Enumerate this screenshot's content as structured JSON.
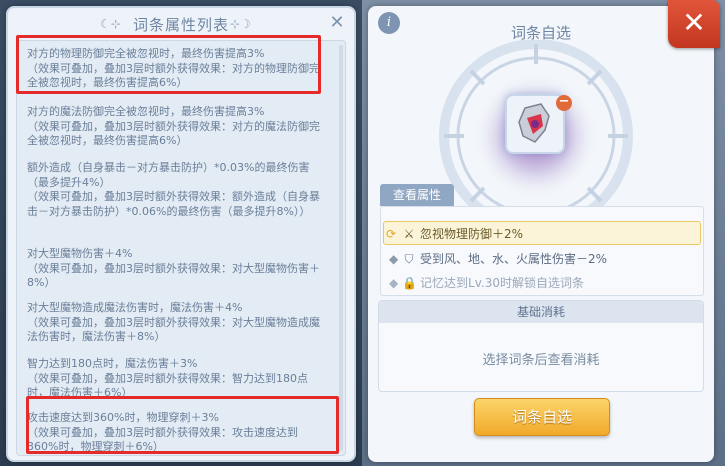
{
  "left": {
    "title": "词条属性列表",
    "items": [
      {
        "main": "对方的物理防御完全被忽视时，最终伤害提高3%",
        "sub": "（效果可叠加，叠加3层时额外获得效果：对方的物理防御完全被忽视时，最终伤害提高6%）"
      },
      {
        "main": "对方的魔法防御完全被忽视时，最终伤害提高3%",
        "sub": "（效果可叠加，叠加3层时额外获得效果：对方的魔法防御完全被忽视时，最终伤害提高6%）"
      },
      {
        "main": "额外造成（自身暴击－对方暴击防护）*0.03%的最终伤害（最多提升4%）",
        "sub": "（效果可叠加，叠加3层时额外获得效果：额外造成（自身暴击－对方暴击防护）*0.06%的最终伤害（最多提升8%））"
      },
      {
        "main": "对大型魔物伤害＋4%",
        "sub": "（效果可叠加，叠加3层时额外获得效果：对大型魔物伤害＋8%）"
      },
      {
        "main": "对大型魔物造成魔法伤害时，魔法伤害＋4%",
        "sub": "（效果可叠加，叠加3层时额外获得效果：对大型魔物造成魔法伤害时，魔法伤害＋8%）"
      },
      {
        "main": "智力达到180点时，魔法伤害＋3%",
        "sub": "（效果可叠加，叠加3层时额外获得效果：智力达到180点时，魔法伤害＋6%）"
      },
      {
        "main": "攻击速度达到360%时，物理穿刺＋3%",
        "sub": "（效果可叠加，叠加3层时额外获得效果：攻击速度达到360%时，物理穿刺＋6%）"
      }
    ]
  },
  "right": {
    "info_icon": "i",
    "title": "词条自选",
    "close_icon": "✕",
    "view_attr_tab": "查看属性",
    "attrs": [
      {
        "text": "忽视物理防御＋2%",
        "icon": "swap-icon"
      },
      {
        "text": "受到风、地、水、火属性伤害－2%",
        "icon": "shield-icon"
      },
      {
        "text": "记忆达到Lv.30时解锁自选词条",
        "icon": "lock-icon"
      }
    ],
    "consume_title": "基础消耗",
    "consume_text": "选择词条后查看消耗",
    "select_button": "词条自选"
  },
  "colors": {
    "highlight": "#e52a2a",
    "button": "#f1a92a",
    "close": "#d0432a"
  }
}
